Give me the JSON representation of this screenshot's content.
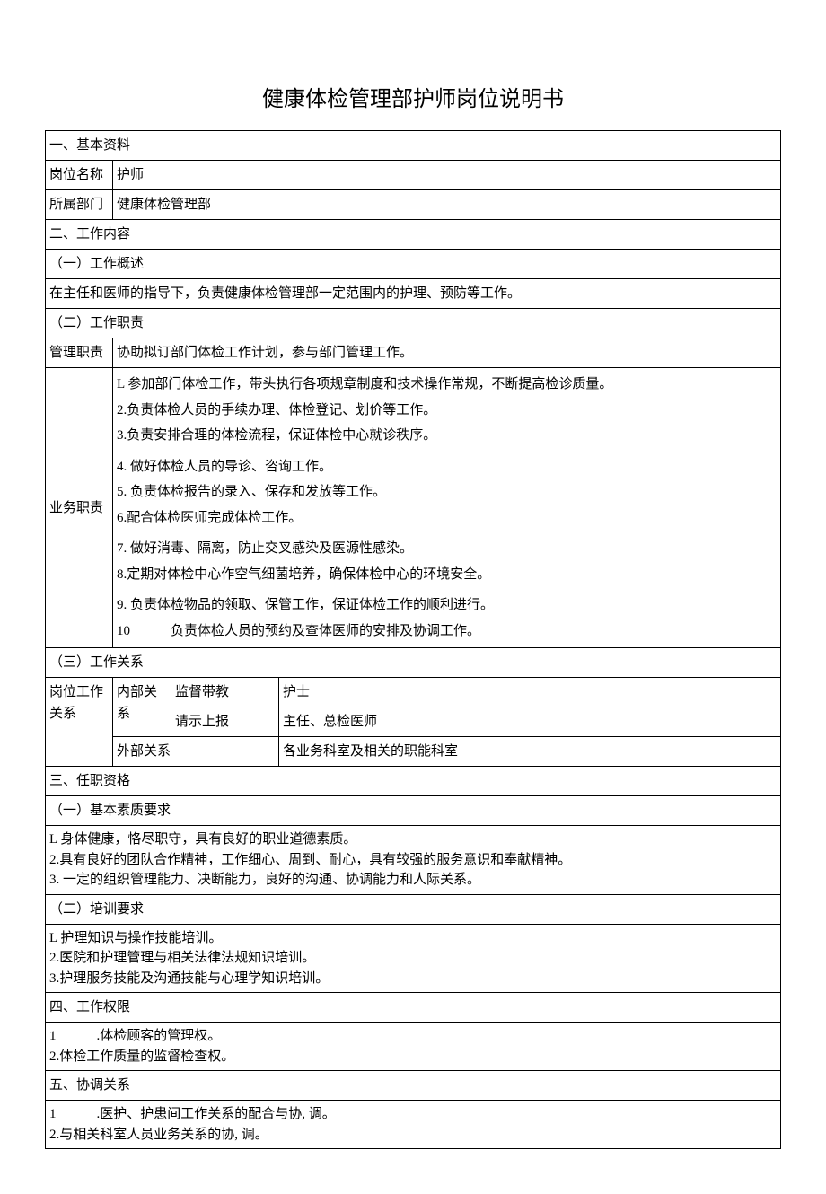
{
  "title": "健康体检管理部护师岗位说明书",
  "s1": {
    "header": "一、基本资料",
    "row1_label": "岗位名称",
    "row1_value": "护师",
    "row2_label": "所属部门",
    "row2_value": "健康体检管理部"
  },
  "s2": {
    "header": "二、工作内容",
    "sub1": "（一）工作概述",
    "sub1_text": "在主任和医师的指导下，负责健康体检管理部一定范围内的护理、预防等工作。",
    "sub2": "（二）工作职责",
    "mgmt_label": "管理职责",
    "mgmt_text": "协助拟订部门体检工作计划，参与部门管理工作。",
    "biz_label": "业务职责",
    "biz_l1": "L 参加部门体检工作，带头执行各项规章制度和技术操作常规，不断提高检诊质量。",
    "biz_l2": "2.负责体检人员的手续办理、体检登记、划价等工作。",
    "biz_l3": "3.负责安排合理的体检流程，保证体检中心就诊秩序。",
    "biz_l4": "4. 做好体检人员的导诊、咨询工作。",
    "biz_l5": "5. 负责体检报告的录入、保存和发放等工作。",
    "biz_l6": "6.配合体检医师完成体检工作。",
    "biz_l7": "7. 做好消毒、隔离，防止交叉感染及医源性感染。",
    "biz_l8": "8.定期对体检中心作空气细菌培养，确保体检中心的环境安全。",
    "biz_l9": "9. 负责体检物品的领取、保管工作，保证体检工作的顺利进行。",
    "biz_l10": "10　　　负责体检人员的预约及查体医师的安排及协调工作。",
    "sub3": "（三）工作关系",
    "rel_label": "岗位工作关系",
    "rel_internal": "内部关系",
    "rel_sup": "监督带教",
    "rel_sup_v": "护士",
    "rel_rep": "请示上报",
    "rel_rep_v": "主任、总检医师",
    "rel_external": "外部关系",
    "rel_external_v": "各业务科室及相关的职能科室"
  },
  "s3": {
    "header": "三、任职资格",
    "sub1": "（一）基本素质要求",
    "q_l1": "L 身体健康，恪尽职守，具有良好的职业道德素质。",
    "q_l2": "2.具有良好的团队合作精神，工作细心、周到、耐心，具有较强的服务意识和奉献精神。",
    "q_l3": "3. 一定的组织管理能力、决断能力，良好的沟通、协调能力和人际关系。",
    "sub2": "（二）培训要求",
    "t_l1": "L 护理知识与操作技能培训。",
    "t_l2": "2.医院和护理管理与相关法律法规知识培训。",
    "t_l3": "3.护理服务技能及沟通技能与心理学知识培训。"
  },
  "s4": {
    "header": "四、工作权限",
    "l1": "1　　　.体检顾客的管理权。",
    "l2": "2.体检工作质量的监督检查权。"
  },
  "s5": {
    "header": "五、协调关系",
    "l1": "1　　　.医护、护患间工作关系的配合与协, 调。",
    "l2": "2.与相关科室人员业务关系的协, 调。"
  }
}
